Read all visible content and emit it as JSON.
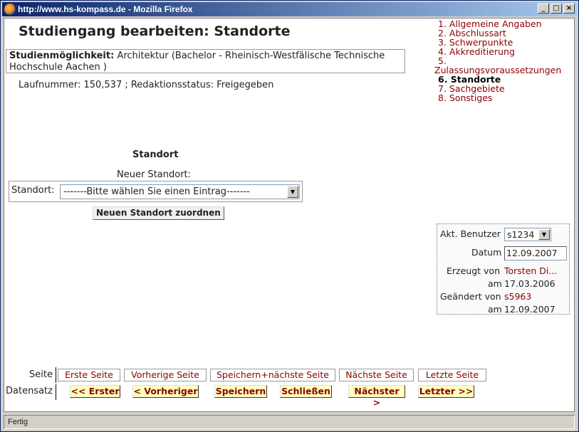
{
  "window": {
    "title": "http://www.hs-kompass.de - Mozilla Firefox",
    "controls": {
      "minimize": "_",
      "maximize": "□",
      "close": "×"
    }
  },
  "page": {
    "title": "Studiengang bearbeiten: Standorte",
    "studienmoeglichkeit_label": "Studienmöglichkeit:",
    "studienmoeglichkeit_value": "Architektur (Bachelor - Rheinisch-Westfälische Technische Hochschule Aachen )",
    "laufnummer_text": "Laufnummer: 150,537 ; Redaktionsstatus: Freigegeben"
  },
  "nav": {
    "items": [
      {
        "label": "1. Allgemeine Angaben"
      },
      {
        "label": "2. Abschlussart"
      },
      {
        "label": "3. Schwerpunkte"
      },
      {
        "label": "4. Akkreditierung"
      },
      {
        "label": "5."
      },
      {
        "label": "Zulassungsvoraussetzungen"
      },
      {
        "label": "6. Standorte",
        "active": true
      },
      {
        "label": "7. Sachgebiete"
      },
      {
        "label": "8. Sonstiges"
      }
    ]
  },
  "standort": {
    "heading": "Standort",
    "new_label": "Neuer Standort:",
    "field_label": "Standort:",
    "select_value": "-------Bitte wählen Sie einen Eintrag-------",
    "assign_button": "Neuen Standort zuordnen"
  },
  "info": {
    "user_label": "Akt. Benutzer",
    "user_value": "s1234",
    "date_label": "Datum",
    "date_value": "12.09.2007",
    "created_by_label": "Erzeugt von",
    "created_by": "Torsten Di...",
    "created_on_label": "am",
    "created_on": "17.03.2006",
    "changed_by_label": "Geändert von",
    "changed_by": "s5963",
    "changed_on_label": "am",
    "changed_on": "12.09.2007"
  },
  "pager": {
    "seite_label": "Seite",
    "datensatz_label": "Datensatz",
    "seite_buttons": [
      "Erste Seite",
      "Vorherige Seite",
      "Speichern+nächste Seite",
      "Nächste Seite",
      "Letzte Seite"
    ],
    "datensatz_buttons": [
      "<< Erster",
      "< Vorheriger",
      "Speichern",
      "Schließen",
      "Nächster >",
      "Letzter >>"
    ]
  },
  "status": {
    "text": "Fertig"
  }
}
